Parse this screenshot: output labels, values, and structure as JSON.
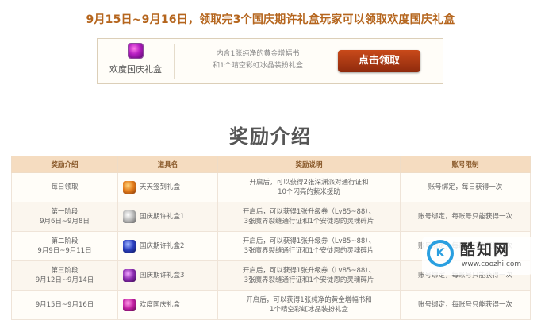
{
  "headline": "9月15日~9月16日，领取完3个国庆期许礼盒玩家可以领取欢度国庆礼盒",
  "claim": {
    "gift_name": "欢度国庆礼盒",
    "desc_line1": "内含1张纯净的黄金增幅书",
    "desc_line2": "和1个晴空彩虹冰晶装扮礼盒",
    "button_label": "点击领取"
  },
  "section_title": "奖励介绍",
  "table": {
    "headers": [
      "奖励介绍",
      "道具名",
      "奖励说明",
      "账号限制"
    ],
    "rows": [
      {
        "period_line1": "每日领取",
        "period_line2": "",
        "item_name": "天天签到礼盒",
        "icon": "orange-giftbox-icon",
        "icon_color": "#e27b1a",
        "desc_line1": "开启后，可以获得2张深渊派对通行证和",
        "desc_line2": "10个闪亮的紫米援助",
        "limit": "账号绑定，每日获得一次"
      },
      {
        "period_line1": "第一阶段",
        "period_line2": "9月6日~9月8日",
        "item_name": "国庆期许礼盒1",
        "icon": "silver-giftbox-icon",
        "icon_color": "#b9b9b9",
        "desc_line1": "开启后，可以获得1张升级券（Lv85~88）、",
        "desc_line2": "3张魔界裂缝通行证和1个安徒恩的灵魂碎片",
        "limit": "账号绑定，每账号只能获得一次"
      },
      {
        "period_line1": "第二阶段",
        "period_line2": "9月9日~9月11日",
        "item_name": "国庆期许礼盒2",
        "icon": "blue-giftbox-icon",
        "icon_color": "#2b3fbf",
        "desc_line1": "开启后，可以获得1张升级券（Lv85~88）、",
        "desc_line2": "3张魔界裂缝通行证和1个安徒恩的灵魂碎片",
        "limit": "账号绑定，每账号只能获得一次"
      },
      {
        "period_line1": "第三阶段",
        "period_line2": "9月12日~9月14日",
        "item_name": "国庆期许礼盒3",
        "icon": "purple-giftbox-icon",
        "icon_color": "#8b2bb0",
        "desc_line1": "开启后，可以获得1张升级券（Lv85~88）、",
        "desc_line2": "3张魔界裂缝通行证和1个安徒恩的灵魂碎片",
        "limit": "账号绑定，每账号只能获得一次"
      },
      {
        "period_line1": "9月15日~9月16日",
        "period_line2": "",
        "item_name": "欢度国庆礼盒",
        "icon": "magenta-giftbox-icon",
        "icon_color": "#c21fa1",
        "desc_line1": "开启后，可以获得1张纯净的黄金增幅书和",
        "desc_line2": "1个晴空彩虹冰晶装扮礼盒",
        "limit": "账号绑定，每账号只能获得一次"
      }
    ]
  },
  "watermark": {
    "logo_letter": "K",
    "name": "酷知网",
    "url": "www.coozhi.com"
  },
  "colors": {
    "headline": "#b5651d",
    "button": "#b23c14",
    "table_header": "#f5dcc0"
  }
}
